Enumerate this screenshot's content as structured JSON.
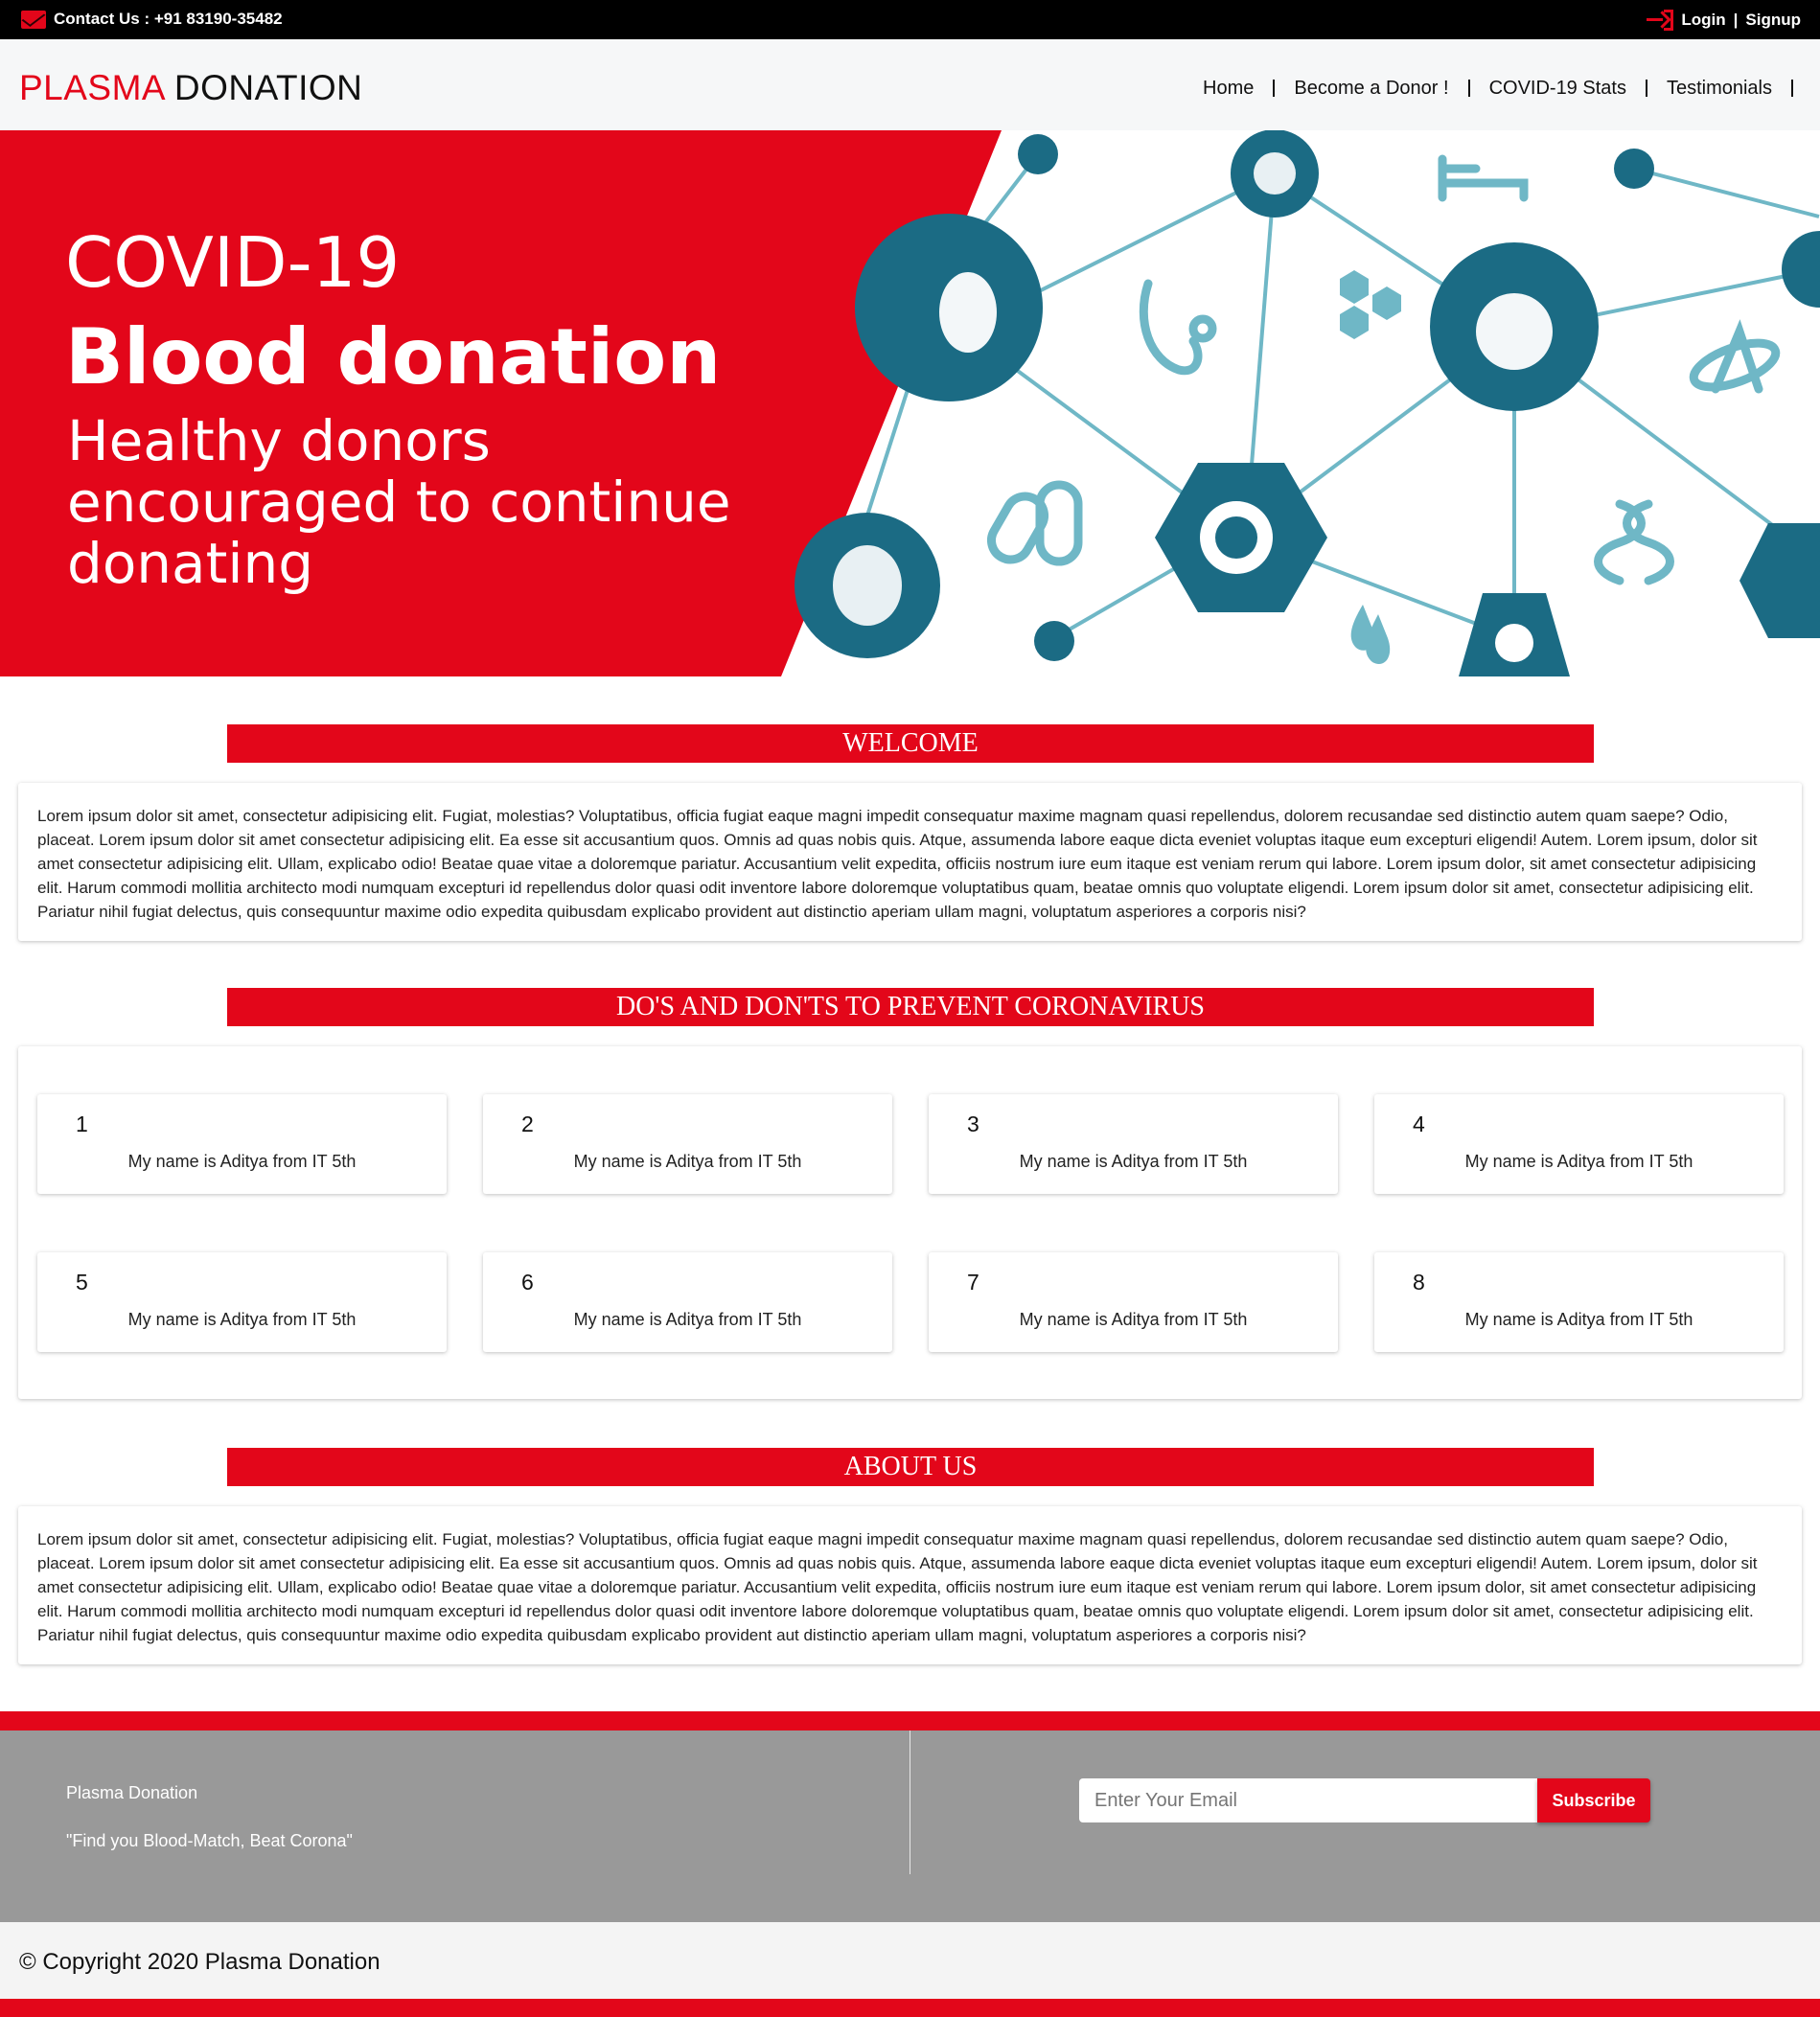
{
  "topbar": {
    "contact": "Contact Us : +91 83190-35482",
    "login": "Login",
    "separator": "|",
    "signup": "Signup"
  },
  "brand": {
    "part1": "PLASMA",
    "part2": "DONATION"
  },
  "nav": [
    "Home",
    "Become a Donor !",
    "COVID-19 Stats",
    "Testimonials"
  ],
  "hero": {
    "line1": "COVID-19",
    "line2": "Blood donation",
    "line3": "Healthy donors encouraged to continue donating"
  },
  "welcome": {
    "title": "WELCOME",
    "text": "Lorem ipsum dolor sit amet, consectetur adipisicing elit. Fugiat, molestias? Voluptatibus, officia fugiat eaque magni impedit consequatur maxime magnam quasi repellendus, dolorem recusandae sed distinctio autem quam saepe? Odio, placeat. Lorem ipsum dolor sit amet consectetur adipisicing elit. Ea esse sit accusantium quos. Omnis ad quas nobis quis. Atque, assumenda labore eaque dicta eveniet voluptas itaque eum excepturi eligendi! Autem. Lorem ipsum, dolor sit amet consectetur adipisicing elit. Ullam, explicabo odio! Beatae quae vitae a doloremque pariatur. Accusantium velit expedita, officiis nostrum iure eum itaque est veniam rerum qui labore. Lorem ipsum dolor, sit amet consectetur adipisicing elit. Harum commodi mollitia architecto modi numquam excepturi id repellendus dolor quasi odit inventore labore doloremque voluptatibus quam, beatae omnis quo voluptate eligendi. Lorem ipsum dolor sit amet, consectetur adipisicing elit. Pariatur nihil fugiat delectus, quis consequuntur maxime odio expedita quibusdam explicabo provident aut distinctio aperiam ullam magni, voluptatum asperiores a corporis nisi?"
  },
  "dos": {
    "title": "DO'S AND DON'TS TO PREVENT CORONAVIRUS",
    "tiles": [
      {
        "num": "1",
        "text": "My name is Aditya from IT 5th"
      },
      {
        "num": "2",
        "text": "My name is Aditya from IT 5th"
      },
      {
        "num": "3",
        "text": "My name is Aditya from IT 5th"
      },
      {
        "num": "4",
        "text": "My name is Aditya from IT 5th"
      },
      {
        "num": "5",
        "text": "My name is Aditya from IT 5th"
      },
      {
        "num": "6",
        "text": "My name is Aditya from IT 5th"
      },
      {
        "num": "7",
        "text": "My name is Aditya from IT 5th"
      },
      {
        "num": "8",
        "text": "My name is Aditya from IT 5th"
      }
    ]
  },
  "about": {
    "title": "ABOUT US",
    "text": "Lorem ipsum dolor sit amet, consectetur adipisicing elit. Fugiat, molestias? Voluptatibus, officia fugiat eaque magni impedit consequatur maxime magnam quasi repellendus, dolorem recusandae sed distinctio autem quam saepe? Odio, placeat. Lorem ipsum dolor sit amet consectetur adipisicing elit. Ea esse sit accusantium quos. Omnis ad quas nobis quis. Atque, assumenda labore eaque dicta eveniet voluptas itaque eum excepturi eligendi! Autem. Lorem ipsum, dolor sit amet consectetur adipisicing elit. Ullam, explicabo odio! Beatae quae vitae a doloremque pariatur. Accusantium velit expedita, officiis nostrum iure eum itaque est veniam rerum qui labore. Lorem ipsum dolor, sit amet consectetur adipisicing elit. Harum commodi mollitia architecto modi numquam excepturi id repellendus dolor quasi odit inventore labore doloremque voluptatibus quam, beatae omnis quo voluptate eligendi. Lorem ipsum dolor sit amet, consectetur adipisicing elit. Pariatur nihil fugiat delectus, quis consequuntur maxime odio expedita quibusdam explicabo provident aut distinctio aperiam ullam magni, voluptatum asperiores a corporis nisi?"
  },
  "footer": {
    "name": "Plasma Donation",
    "slogan": "\"Find you Blood-Match, Beat Corona\"",
    "email_placeholder": "Enter Your Email",
    "subscribe": "Subscribe"
  },
  "copyright": "© Copyright 2020 Plasma Donation",
  "colors": {
    "accent": "#e3061a",
    "icon_dark": "#1b6b84",
    "icon_light": "#6fb7c6",
    "footer_bg": "#999999"
  },
  "icons": [
    "mail-icon",
    "login-icon",
    "mask-icon",
    "phone-icon",
    "bed-icon",
    "handwash-icon",
    "stethoscope-icon",
    "virus-icon",
    "lungs-icon",
    "pills-icon",
    "dna-icon",
    "doctor-icon",
    "thermometer-icon",
    "drops-icon",
    "hexagon-cluster-icon",
    "atom-icon"
  ]
}
